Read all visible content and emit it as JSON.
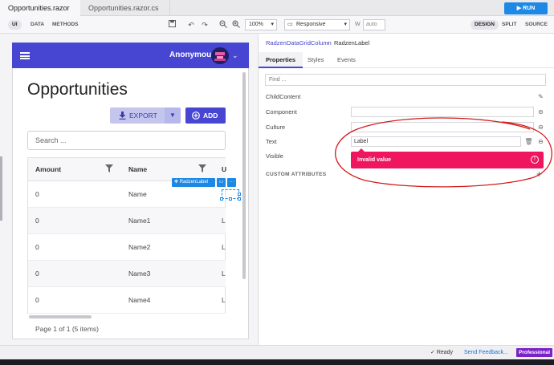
{
  "file_tabs": [
    {
      "label": "Opportunities.razor",
      "active": true,
      "modified": true
    },
    {
      "label": "Opportunities.razor.cs",
      "active": false
    }
  ],
  "run_label": "RUN",
  "toolbar": {
    "modes": [
      "UI",
      "DATA",
      "METHODS"
    ],
    "selected_mode": "UI",
    "zoom": "100%",
    "responsive": "Responsive",
    "width_label": "W",
    "width_value": "auto",
    "views": [
      "DESIGN",
      "SPLIT",
      "SOURCE"
    ]
  },
  "app": {
    "user_name": "Anonymous",
    "page_title": "Opportunities",
    "export_label": "EXPORT",
    "add_label": "ADD",
    "search_placeholder": "Search ...",
    "grid": {
      "columns": [
        "Amount",
        "Name",
        "U"
      ],
      "rows": [
        [
          "0",
          "Name",
          ""
        ],
        [
          "0",
          "Name1",
          "L"
        ],
        [
          "0",
          "Name2",
          "L"
        ],
        [
          "0",
          "Name3",
          "L"
        ],
        [
          "0",
          "Name4",
          "L"
        ]
      ]
    },
    "pager_text": "Page 1 of 1 (5 items)",
    "selected_component_chip": "RadzenLabel"
  },
  "panel": {
    "breadcrumb": [
      "RadzenDataGridColumn",
      "RadzenLabel"
    ],
    "tabs": [
      "Properties",
      "Styles",
      "Events"
    ],
    "selected_tab": "Properties",
    "find_placeholder": "Find ...",
    "properties": [
      {
        "label": "ChildContent",
        "value": null
      },
      {
        "label": "Component",
        "value": ""
      },
      {
        "label": "Culture",
        "value": ""
      },
      {
        "label": "Text",
        "value": "Label"
      },
      {
        "label": "Visible",
        "value": null
      }
    ],
    "validation_message": "Invalid value",
    "custom_attributes_label": "CUSTOM ATTRIBUTES"
  },
  "status": {
    "ready": "Ready",
    "feedback": "Send Feedback...",
    "edition": "Professional"
  },
  "colors": {
    "primary": "#4646d3",
    "run_blue": "#1e88e5",
    "error": "#f0155f",
    "annotation_red": "#d11b1b",
    "pro_purple": "#7b22c7"
  }
}
